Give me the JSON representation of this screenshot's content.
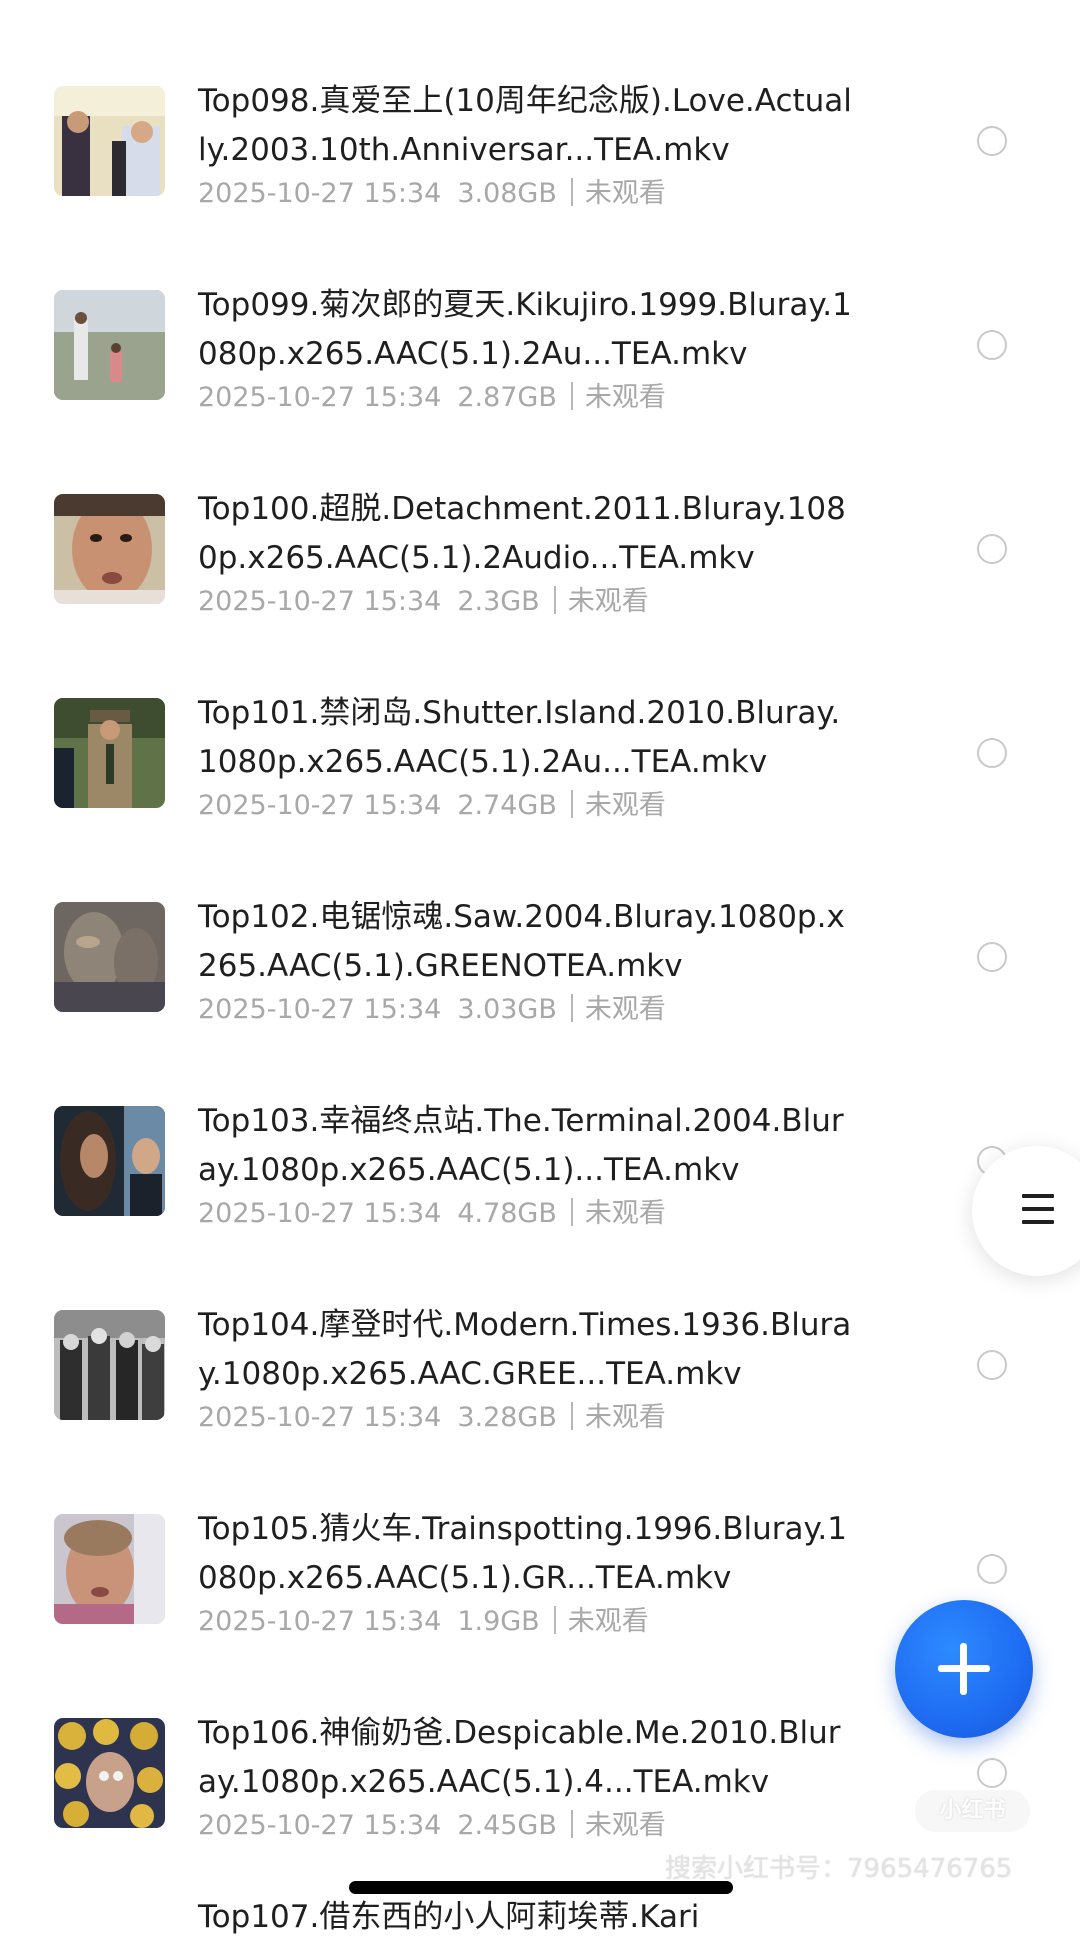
{
  "files": [
    {
      "title": "Top098.真爱至上(10周年纪念版).Love.Actually.2003.10th.Anniversar...TEA.mkv",
      "date": "2025-10-27 15:34",
      "size": "3.08GB",
      "status": "未观看",
      "thumb": "thumb-098"
    },
    {
      "title": "Top099.菊次郎的夏天.Kikujiro.1999.Bluray.1080p.x265.AAC(5.1).2Au...TEA.mkv",
      "date": "2025-10-27 15:34",
      "size": "2.87GB",
      "status": "未观看",
      "thumb": "thumb-099"
    },
    {
      "title": "Top100.超脱.Detachment.2011.Bluray.1080p.x265.AAC(5.1).2Audio...TEA.mkv",
      "date": "2025-10-27 15:34",
      "size": "2.3GB",
      "status": "未观看",
      "thumb": "thumb-100"
    },
    {
      "title": "Top101.禁闭岛.Shutter.Island.2010.Bluray.1080p.x265.AAC(5.1).2Au...TEA.mkv",
      "date": "2025-10-27 15:34",
      "size": "2.74GB",
      "status": "未观看",
      "thumb": "thumb-101"
    },
    {
      "title": "Top102.电锯惊魂.Saw.2004.Bluray.1080p.x265.AAC(5.1).GREENOTEA.mkv",
      "date": "2025-10-27 15:34",
      "size": "3.03GB",
      "status": "未观看",
      "thumb": "thumb-102"
    },
    {
      "title": "Top103.幸福终点站.The.Terminal.2004.Bluray.1080p.x265.AAC(5.1)...TEA.mkv",
      "date": "2025-10-27 15:34",
      "size": "4.78GB",
      "status": "未观看",
      "thumb": "thumb-103"
    },
    {
      "title": "Top104.摩登时代.Modern.Times.1936.Bluray.1080p.x265.AAC.GREE...TEA.mkv",
      "date": "2025-10-27 15:34",
      "size": "3.28GB",
      "status": "未观看",
      "thumb": "thumb-104"
    },
    {
      "title": "Top105.猜火车.Trainspotting.1996.Bluray.1080p.x265.AAC(5.1).GR...TEA.mkv",
      "date": "2025-10-27 15:34",
      "size": "1.9GB",
      "status": "未观看",
      "thumb": "thumb-105"
    },
    {
      "title": "Top106.神偷奶爸.Despicable.Me.2010.Bluray.1080p.x265.AAC(5.1).4...TEA.mkv",
      "date": "2025-10-27 15:34",
      "size": "2.45GB",
      "status": "未观看",
      "thumb": "thumb-106"
    }
  ],
  "peek_title": "Top107.借东西的小人阿莉埃蒂.Kari",
  "side_menu": {
    "icon": "hamburger-menu-icon"
  },
  "fab": {
    "icon": "plus-icon",
    "color": "#1e6cf2"
  },
  "watermark": {
    "logo": "小红书",
    "text": "搜索小红书号：7965476765"
  }
}
